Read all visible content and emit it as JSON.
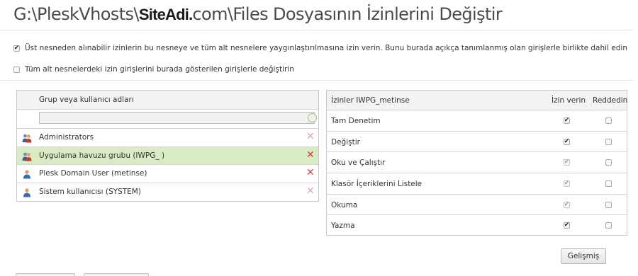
{
  "title": {
    "path_prefix": "G:\\PleskVhosts\\",
    "site_name": "SiteAdi.",
    "path_suffix": "com\\Files Dosyasının İzinlerini Değiştir"
  },
  "options": {
    "inherit": {
      "checked": true,
      "label": "Üst nesneden alınabilir izinlerin bu nesneye ve tüm alt nesnelere yaygınlaştırılmasına izin verin. Bunu burada açıkça tanımlanmış olan girişlerle birlikte dahil edin"
    },
    "replace": {
      "checked": false,
      "label": "Tüm alt nesnelerdeki izin girişlerini burada gösterilen girişlerle değiştirin"
    }
  },
  "principals": {
    "header": "Grup veya kullanıcı adları",
    "select_value": "",
    "items": [
      {
        "label": "Administrators",
        "kind": "group",
        "selected": false,
        "remove_emphasis": false
      },
      {
        "label": "Uygulama havuzu grubu (IWPG_          )",
        "kind": "group",
        "selected": true,
        "remove_emphasis": true
      },
      {
        "label": "Plesk Domain User (metinse)",
        "kind": "user",
        "selected": false,
        "remove_emphasis": true
      },
      {
        "label": "Sistem kullanıcısı (SYSTEM)",
        "kind": "user",
        "selected": false,
        "remove_emphasis": false
      }
    ]
  },
  "permissions": {
    "header_name": "İzinler IWPG_metinse",
    "header_allow": "İzin verin",
    "header_deny": "Reddedin",
    "rows": [
      {
        "label": "Tam Denetim",
        "allow": true,
        "allow_inherited": false,
        "deny": false
      },
      {
        "label": "Değiştir",
        "allow": true,
        "allow_inherited": false,
        "deny": false
      },
      {
        "label": "Oku ve Çalıştır",
        "allow": true,
        "allow_inherited": true,
        "deny": false
      },
      {
        "label": "Klasör İçeriklerini Listele",
        "allow": true,
        "allow_inherited": true,
        "deny": false
      },
      {
        "label": "Okuma",
        "allow": true,
        "allow_inherited": true,
        "deny": false
      },
      {
        "label": "Yazma",
        "allow": true,
        "allow_inherited": false,
        "deny": false
      }
    ]
  },
  "buttons": {
    "advanced": "Gelişmiş"
  },
  "icons": {
    "check": "✔",
    "remove": "✕",
    "dropdown": "▾",
    "group": "group-user-icon",
    "user": "user-icon"
  },
  "colors": {
    "selected_row": "#d8ebc5",
    "remove_strong": "#d04040",
    "remove_faded": "#e7a5a5"
  }
}
